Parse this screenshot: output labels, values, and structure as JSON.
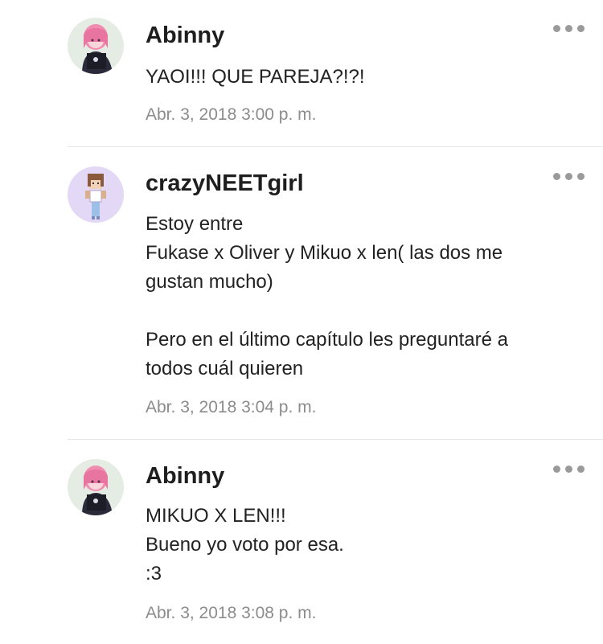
{
  "comments": [
    {
      "author": "Abinny",
      "avatar": "pink-haired-character-avatar",
      "lines": [
        "YAOI!!! QUE PAREJA?!?!"
      ],
      "timestamp": "Abr. 3, 2018 3:00 p. m."
    },
    {
      "author": "crazyNEETgirl",
      "avatar": "pixel-girl-character-avatar",
      "lines": [
        "Estoy entre",
        "Fukase x Oliver y Mikuo x len( las dos me",
        "gustan mucho)",
        "",
        "Pero en el último capítulo les preguntaré a",
        "todos cuál quieren"
      ],
      "timestamp": "Abr. 3, 2018 3:04 p. m."
    },
    {
      "author": "Abinny",
      "avatar": "pink-haired-character-avatar",
      "lines": [
        "MIKUO X LEN!!!",
        "Bueno yo voto por esa.",
        ":3"
      ],
      "timestamp": "Abr. 3, 2018 3:08 p. m."
    }
  ],
  "more_icon": "more-options-icon",
  "colors": {
    "author": "#1e1e1e",
    "text": "#222222",
    "timestamp": "#8c8c8c",
    "dots": "#9a9a9a",
    "divider": "#e6e6e6"
  }
}
